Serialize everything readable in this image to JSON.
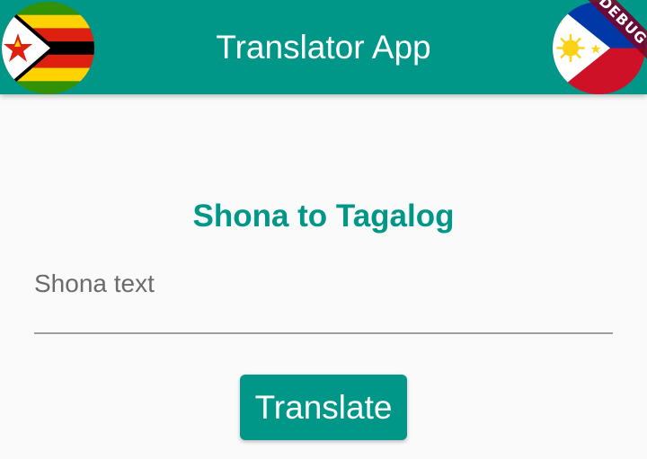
{
  "appbar": {
    "title": "Translator App",
    "left_icon": "zimbabwe-flag-icon",
    "right_icon": "philippines-flag-icon",
    "color": "#009688"
  },
  "debug_banner": {
    "label": "DEBUG"
  },
  "main": {
    "heading": "Shona to Tagalog",
    "input": {
      "label": "Shona text",
      "value": ""
    },
    "translate_button_label": "Translate"
  },
  "colors": {
    "primary": "#009688",
    "background": "#fafafa",
    "label_gray": "#6b6b6b"
  }
}
